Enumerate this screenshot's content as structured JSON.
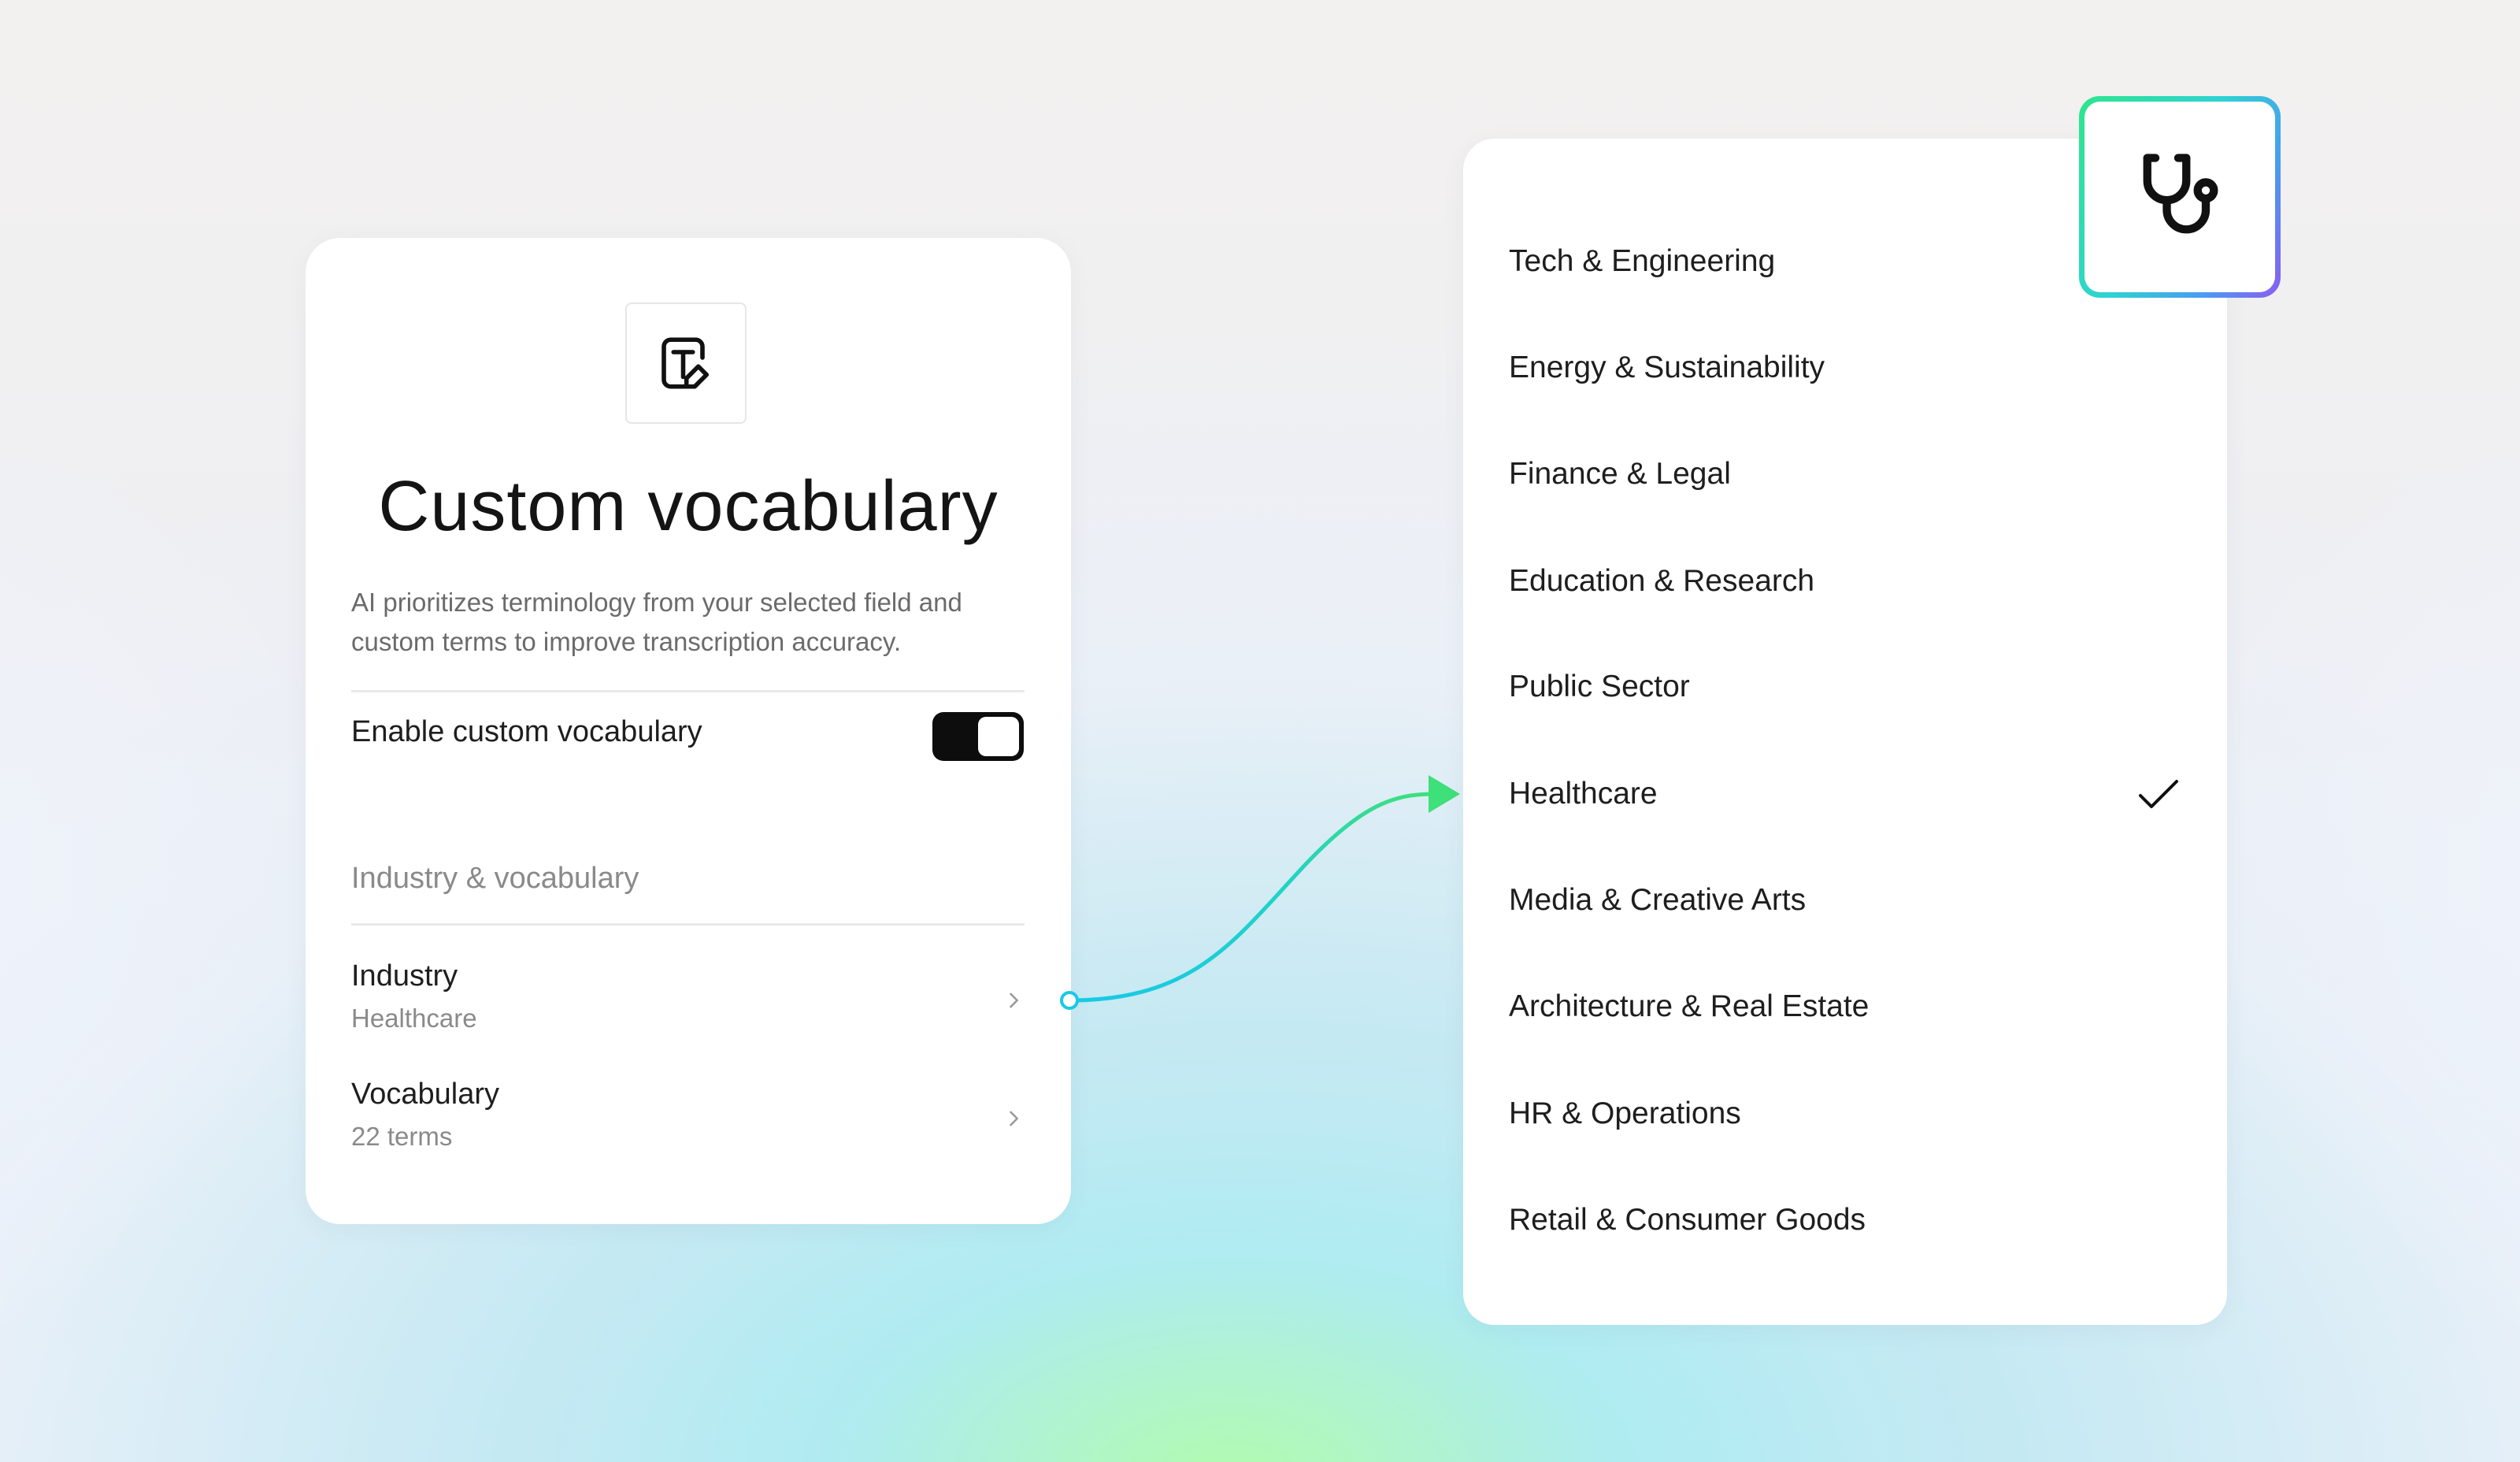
{
  "settings": {
    "title": "Custom vocabulary",
    "description": "AI prioritizes terminology from your selected field and custom terms to improve transcription accuracy.",
    "toggle_label": "Enable custom vocabulary",
    "toggle_on": true,
    "section_label": "Industry & vocabulary",
    "rows": [
      {
        "title": "Industry",
        "subtitle": "Healthcare"
      },
      {
        "title": "Vocabulary",
        "subtitle": "22 terms"
      }
    ],
    "icons": {
      "app": "text-edit-icon",
      "chevron": "chevron-right-icon"
    }
  },
  "industry_list": {
    "items": [
      "Tech & Engineering",
      "Energy & Sustainability",
      "Finance & Legal",
      "Education & Research",
      "Public Sector",
      "Healthcare",
      "Media & Creative Arts",
      "Architecture & Real Estate",
      "HR & Operations",
      "Retail & Consumer Goods"
    ],
    "selected": "Healthcare",
    "selected_icon": "check-icon",
    "badge_icon": "stethoscope-icon"
  },
  "colors": {
    "connector_start": "#18c9e6",
    "connector_end": "#3ee07a",
    "toggle_on": "#0d0d0d",
    "badge_gradient": [
      "#2ee68c",
      "#2fd3d2",
      "#4a9cf0",
      "#8a5cf2"
    ]
  }
}
